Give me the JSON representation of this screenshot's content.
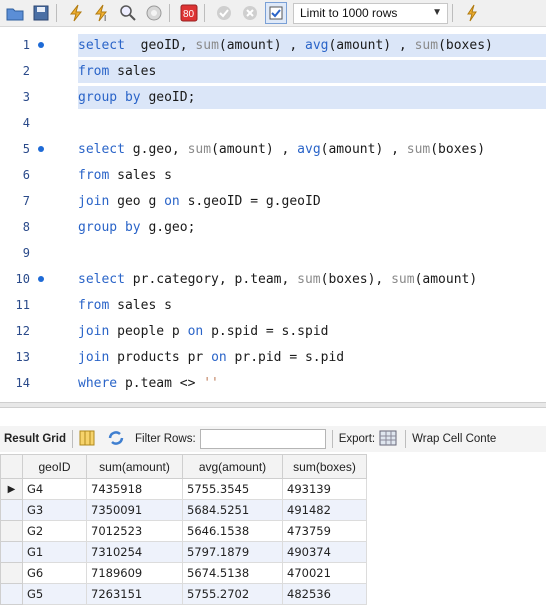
{
  "toolbar": {
    "icons": [
      "folder-open-icon",
      "save-icon",
      "execute-icon",
      "execute-current-icon",
      "explain-icon",
      "stop-icon",
      "toggle-continue-icon",
      "commit-icon",
      "rollback-icon",
      "autocommit-icon"
    ],
    "limit_label": "Limit to 1000 rows"
  },
  "editor": {
    "lines": [
      {
        "num": "1",
        "dot": true,
        "highlight": true,
        "tokens": [
          [
            "kw",
            "select"
          ],
          [
            "",
            "  geoID, "
          ],
          [
            "fn",
            "sum"
          ],
          [
            "",
            "(amount) , "
          ],
          [
            "kw",
            "avg"
          ],
          [
            "",
            "(amount) , "
          ],
          [
            "fn",
            "sum"
          ],
          [
            "",
            "(boxes)"
          ]
        ]
      },
      {
        "num": "2",
        "dot": false,
        "highlight": true,
        "tokens": [
          [
            "kw",
            "from"
          ],
          [
            "",
            " sales"
          ]
        ]
      },
      {
        "num": "3",
        "dot": false,
        "highlight": true,
        "tokens": [
          [
            "kw",
            "group by"
          ],
          [
            "",
            " geoID;"
          ]
        ]
      },
      {
        "num": "4",
        "dot": false,
        "highlight": false,
        "tokens": []
      },
      {
        "num": "5",
        "dot": true,
        "highlight": false,
        "tokens": [
          [
            "kw",
            "select"
          ],
          [
            "",
            " g.geo, "
          ],
          [
            "fn",
            "sum"
          ],
          [
            "",
            "(amount) , "
          ],
          [
            "kw",
            "avg"
          ],
          [
            "",
            "(amount) , "
          ],
          [
            "fn",
            "sum"
          ],
          [
            "",
            "(boxes)"
          ]
        ]
      },
      {
        "num": "6",
        "dot": false,
        "highlight": false,
        "tokens": [
          [
            "kw",
            "from"
          ],
          [
            "",
            " sales s"
          ]
        ]
      },
      {
        "num": "7",
        "dot": false,
        "highlight": false,
        "tokens": [
          [
            "kw",
            "join"
          ],
          [
            "",
            " geo g "
          ],
          [
            "kw",
            "on"
          ],
          [
            "",
            " s.geoID = g.geoID"
          ]
        ]
      },
      {
        "num": "8",
        "dot": false,
        "highlight": false,
        "tokens": [
          [
            "kw",
            "group by"
          ],
          [
            "",
            " g.geo;"
          ]
        ]
      },
      {
        "num": "9",
        "dot": false,
        "highlight": false,
        "tokens": []
      },
      {
        "num": "10",
        "dot": true,
        "highlight": false,
        "tokens": [
          [
            "kw",
            "select"
          ],
          [
            "",
            " pr.category, p.team, "
          ],
          [
            "fn",
            "sum"
          ],
          [
            "",
            "(boxes), "
          ],
          [
            "fn",
            "sum"
          ],
          [
            "",
            "(amount)"
          ]
        ]
      },
      {
        "num": "11",
        "dot": false,
        "highlight": false,
        "tokens": [
          [
            "kw",
            "from"
          ],
          [
            "",
            " sales s"
          ]
        ]
      },
      {
        "num": "12",
        "dot": false,
        "highlight": false,
        "tokens": [
          [
            "kw",
            "join"
          ],
          [
            "",
            " people p "
          ],
          [
            "kw",
            "on"
          ],
          [
            "",
            " p.spid = s.spid"
          ]
        ]
      },
      {
        "num": "13",
        "dot": false,
        "highlight": false,
        "tokens": [
          [
            "kw",
            "join"
          ],
          [
            "",
            " products pr "
          ],
          [
            "kw",
            "on"
          ],
          [
            "",
            " pr.pid = s.pid"
          ]
        ]
      },
      {
        "num": "14",
        "dot": false,
        "highlight": false,
        "tokens": [
          [
            "kw",
            "where"
          ],
          [
            "",
            " p.team <> "
          ],
          [
            "str",
            "''"
          ]
        ]
      }
    ]
  },
  "results": {
    "tab_label": "Result Grid",
    "filter_label": "Filter Rows:",
    "export_label": "Export:",
    "wrap_label": "Wrap Cell Conte",
    "columns": [
      "geoID",
      "sum(amount)",
      "avg(amount)",
      "sum(boxes)"
    ],
    "rows": [
      [
        "G4",
        "7435918",
        "5755.3545",
        "493139"
      ],
      [
        "G3",
        "7350091",
        "5684.5251",
        "491482"
      ],
      [
        "G2",
        "7012523",
        "5646.1538",
        "473759"
      ],
      [
        "G1",
        "7310254",
        "5797.1879",
        "490374"
      ],
      [
        "G6",
        "7189609",
        "5674.5138",
        "470021"
      ],
      [
        "G5",
        "7263151",
        "5755.2702",
        "482536"
      ]
    ]
  }
}
